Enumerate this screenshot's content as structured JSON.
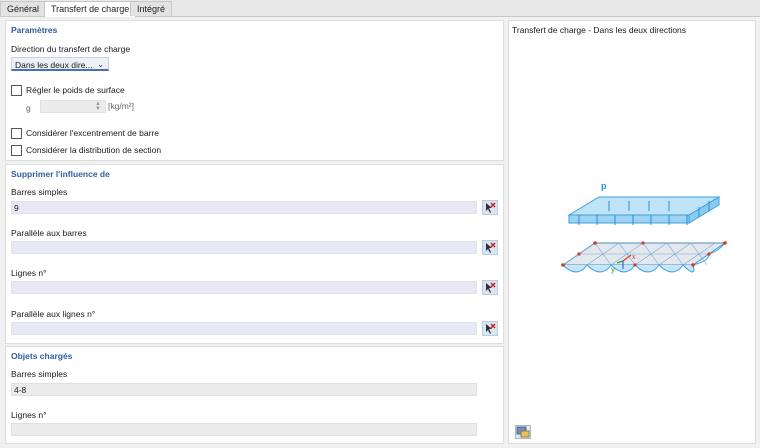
{
  "tabs": [
    "Général",
    "Transfert de charge",
    "Intégré"
  ],
  "parametres": {
    "title": "Paramètres",
    "direction_label": "Direction du transfert de charge",
    "direction_value": "Dans les deux dire...",
    "surface_weight_label": "Régler le poids de surface",
    "g_label": "g",
    "unit": "[kg/m²]",
    "eccentricity_label": "Considérer l'excentrement de barre",
    "section_distribution_label": "Considérer la distribution de section"
  },
  "supprimer": {
    "title": "Supprimer l'influence de",
    "barres_simples_label": "Barres simples",
    "barres_simples_value": "9",
    "parallele_barres_label": "Parallèle aux barres",
    "lignes_label": "Lignes n°",
    "parallele_lignes_label": "Parallèle aux lignes n°"
  },
  "objets": {
    "title": "Objets chargés",
    "barres_simples_label": "Barres simples",
    "barres_simples_value": "4-8",
    "lignes_label": "Lignes n°"
  },
  "preview": {
    "title": "Transfert de charge - Dans les deux directions",
    "load_label": "p",
    "axis_x": "x",
    "axis_y": "y"
  },
  "colors": {
    "accent": "#2f5f9e",
    "load_blue": "#3aa0e0",
    "field_bg": "#e7e8f3"
  }
}
